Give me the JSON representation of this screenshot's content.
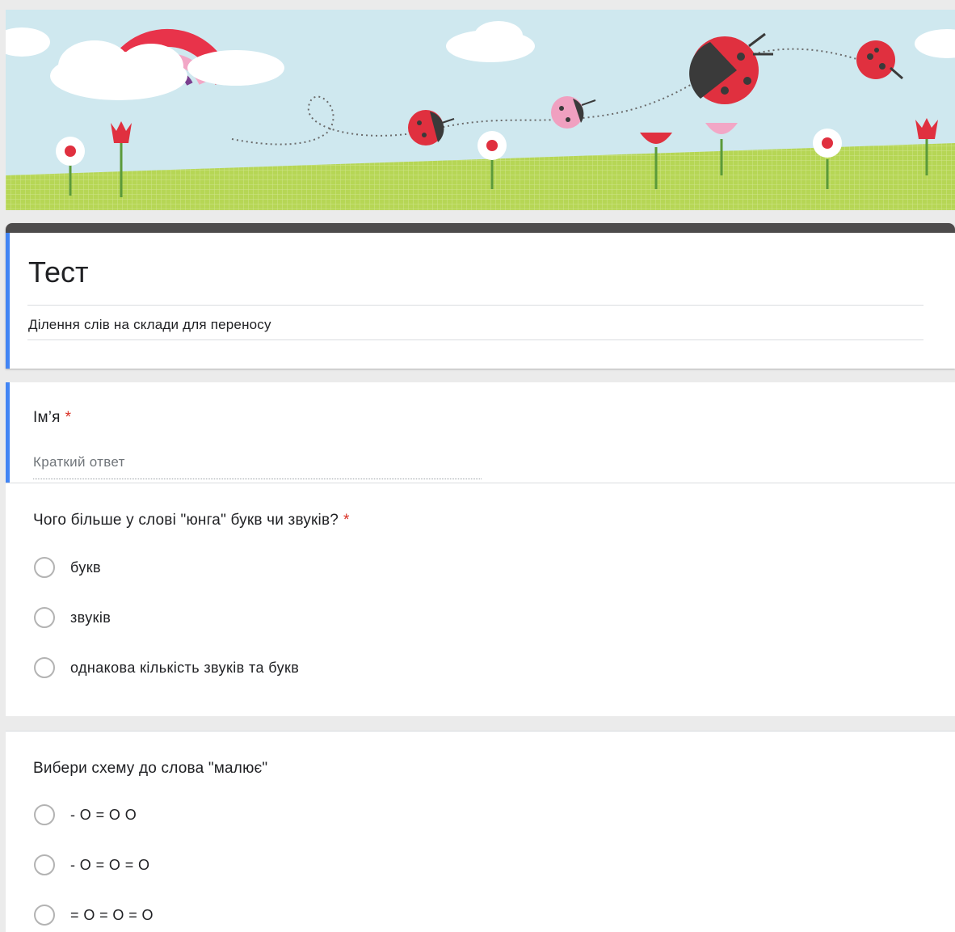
{
  "form": {
    "title": "Тест",
    "description": "Ділення слів на склади для переносу",
    "accent_color": "#4285f4",
    "header_bar_color": "#4d4b4b",
    "required_marker": "*",
    "required_color": "#d93025"
  },
  "questions": [
    {
      "title": "Ім’я",
      "required": true,
      "type": "short-answer",
      "placeholder": "Краткий ответ"
    },
    {
      "title": "Чого більше у слові \"юнга\" букв чи звуків?",
      "required": true,
      "type": "radio",
      "options": [
        "букв",
        "звуків",
        "однакова кількість звуків та букв"
      ]
    },
    {
      "title": "Вибери схему до слова  \"малює\"",
      "required": false,
      "type": "radio",
      "options": [
        "- O = O O",
        "- O = O = O",
        "= O = O = O"
      ]
    }
  ]
}
